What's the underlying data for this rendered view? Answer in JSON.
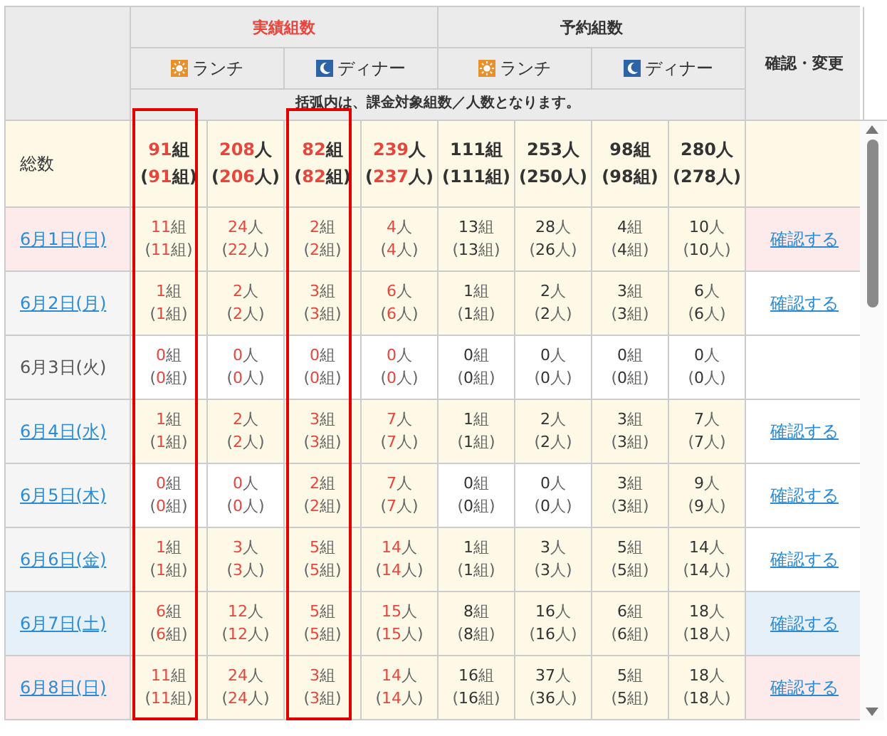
{
  "header": {
    "groups": [
      {
        "kind": "actual",
        "label": "実績組数"
      },
      {
        "kind": "reserved",
        "label": "予約組数"
      }
    ],
    "meals": [
      {
        "kind": "sun",
        "label": "ランチ"
      },
      {
        "kind": "moon",
        "label": "ディナー"
      },
      {
        "kind": "sun",
        "label": "ランチ"
      },
      {
        "kind": "moon",
        "label": "ディナー"
      }
    ],
    "note": "括弧内は、課金対象組数／人数となります。",
    "confirm_label": "確認・変更"
  },
  "columns": [
    {
      "kind": "actual",
      "framed": true
    },
    {
      "kind": "actual",
      "framed": false
    },
    {
      "kind": "actual",
      "framed": true
    },
    {
      "kind": "actual",
      "framed": false
    },
    {
      "kind": "reserved",
      "framed": false
    },
    {
      "kind": "reserved",
      "framed": false
    },
    {
      "kind": "reserved",
      "framed": false
    },
    {
      "kind": "reserved",
      "framed": false
    }
  ],
  "total": {
    "label": "総数",
    "cells": [
      {
        "value": [
          "91",
          "組"
        ],
        "billable": [
          "(",
          "91",
          "組)"
        ]
      },
      {
        "value": [
          "208",
          "人"
        ],
        "billable": [
          "(",
          "206",
          "人)"
        ]
      },
      {
        "value": [
          "82",
          "組"
        ],
        "billable": [
          "(",
          "82",
          "組)"
        ]
      },
      {
        "value": [
          "239",
          "人"
        ],
        "billable": [
          "(",
          "237",
          "人)"
        ]
      },
      {
        "value": [
          "111",
          "組"
        ],
        "billable": [
          "(",
          "111",
          "組)"
        ]
      },
      {
        "value": [
          "253",
          "人"
        ],
        "billable": [
          "(",
          "250",
          "人)"
        ]
      },
      {
        "value": [
          "98",
          "組"
        ],
        "billable": [
          "(",
          "98",
          "組)"
        ]
      },
      {
        "value": [
          "280",
          "人"
        ],
        "billable": [
          "(",
          "278",
          "人)"
        ]
      }
    ]
  },
  "rows": [
    {
      "date": "6月1日(日)",
      "kind": "sunday",
      "link": true,
      "action": "確認する",
      "cells": [
        {
          "value": [
            "11",
            "組"
          ],
          "billable": [
            "(",
            "11",
            "組)"
          ],
          "filled": true
        },
        {
          "value": [
            "24",
            "人"
          ],
          "billable": [
            "(",
            "22",
            "人)"
          ],
          "filled": true
        },
        {
          "value": [
            "2",
            "組"
          ],
          "billable": [
            "(",
            "2",
            "組)"
          ],
          "filled": true
        },
        {
          "value": [
            "4",
            "人"
          ],
          "billable": [
            "(",
            "4",
            "人)"
          ],
          "filled": true
        },
        {
          "value": [
            "13",
            "組"
          ],
          "billable": [
            "(",
            "13",
            "組)"
          ],
          "filled": true
        },
        {
          "value": [
            "28",
            "人"
          ],
          "billable": [
            "(",
            "26",
            "人)"
          ],
          "filled": true
        },
        {
          "value": [
            "4",
            "組"
          ],
          "billable": [
            "(",
            "4",
            "組)"
          ],
          "filled": true
        },
        {
          "value": [
            "10",
            "人"
          ],
          "billable": [
            "(",
            "10",
            "人)"
          ],
          "filled": true
        }
      ]
    },
    {
      "date": "6月2日(月)",
      "kind": "weekday",
      "link": true,
      "action": "確認する",
      "cells": [
        {
          "value": [
            "1",
            "組"
          ],
          "billable": [
            "(",
            "1",
            "組)"
          ],
          "filled": true
        },
        {
          "value": [
            "2",
            "人"
          ],
          "billable": [
            "(",
            "2",
            "人)"
          ],
          "filled": true
        },
        {
          "value": [
            "3",
            "組"
          ],
          "billable": [
            "(",
            "3",
            "組)"
          ],
          "filled": true
        },
        {
          "value": [
            "6",
            "人"
          ],
          "billable": [
            "(",
            "6",
            "人)"
          ],
          "filled": true
        },
        {
          "value": [
            "1",
            "組"
          ],
          "billable": [
            "(",
            "1",
            "組)"
          ],
          "filled": true
        },
        {
          "value": [
            "2",
            "人"
          ],
          "billable": [
            "(",
            "2",
            "人)"
          ],
          "filled": true
        },
        {
          "value": [
            "3",
            "組"
          ],
          "billable": [
            "(",
            "3",
            "組)"
          ],
          "filled": true
        },
        {
          "value": [
            "6",
            "人"
          ],
          "billable": [
            "(",
            "6",
            "人)"
          ],
          "filled": true
        }
      ]
    },
    {
      "date": "6月3日(火)",
      "kind": "weekday",
      "link": false,
      "cells": [
        {
          "value": [
            "0",
            "組"
          ],
          "billable": [
            "(",
            "0",
            "組)"
          ],
          "filled": false
        },
        {
          "value": [
            "0",
            "人"
          ],
          "billable": [
            "(",
            "0",
            "人)"
          ],
          "filled": false
        },
        {
          "value": [
            "0",
            "組"
          ],
          "billable": [
            "(",
            "0",
            "組)"
          ],
          "filled": false
        },
        {
          "value": [
            "0",
            "人"
          ],
          "billable": [
            "(",
            "0",
            "人)"
          ],
          "filled": false
        },
        {
          "value": [
            "0",
            "組"
          ],
          "billable": [
            "(",
            "0",
            "組)"
          ],
          "filled": false
        },
        {
          "value": [
            "0",
            "人"
          ],
          "billable": [
            "(",
            "0",
            "人)"
          ],
          "filled": false
        },
        {
          "value": [
            "0",
            "組"
          ],
          "billable": [
            "(",
            "0",
            "組)"
          ],
          "filled": false
        },
        {
          "value": [
            "0",
            "人"
          ],
          "billable": [
            "(",
            "0",
            "人)"
          ],
          "filled": false
        }
      ]
    },
    {
      "date": "6月4日(水)",
      "kind": "weekday",
      "link": true,
      "action": "確認する",
      "cells": [
        {
          "value": [
            "1",
            "組"
          ],
          "billable": [
            "(",
            "1",
            "組)"
          ],
          "filled": true
        },
        {
          "value": [
            "2",
            "人"
          ],
          "billable": [
            "(",
            "2",
            "人)"
          ],
          "filled": true
        },
        {
          "value": [
            "3",
            "組"
          ],
          "billable": [
            "(",
            "3",
            "組)"
          ],
          "filled": true
        },
        {
          "value": [
            "7",
            "人"
          ],
          "billable": [
            "(",
            "7",
            "人)"
          ],
          "filled": true
        },
        {
          "value": [
            "1",
            "組"
          ],
          "billable": [
            "(",
            "1",
            "組)"
          ],
          "filled": true
        },
        {
          "value": [
            "2",
            "人"
          ],
          "billable": [
            "(",
            "2",
            "人)"
          ],
          "filled": true
        },
        {
          "value": [
            "3",
            "組"
          ],
          "billable": [
            "(",
            "3",
            "組)"
          ],
          "filled": true
        },
        {
          "value": [
            "7",
            "人"
          ],
          "billable": [
            "(",
            "7",
            "人)"
          ],
          "filled": true
        }
      ]
    },
    {
      "date": "6月5日(木)",
      "kind": "weekday",
      "link": true,
      "action": "確認する",
      "cells": [
        {
          "value": [
            "0",
            "組"
          ],
          "billable": [
            "(",
            "0",
            "組)"
          ],
          "filled": false
        },
        {
          "value": [
            "0",
            "人"
          ],
          "billable": [
            "(",
            "0",
            "人)"
          ],
          "filled": false
        },
        {
          "value": [
            "2",
            "組"
          ],
          "billable": [
            "(",
            "2",
            "組)"
          ],
          "filled": true
        },
        {
          "value": [
            "7",
            "人"
          ],
          "billable": [
            "(",
            "7",
            "人)"
          ],
          "filled": true
        },
        {
          "value": [
            "0",
            "組"
          ],
          "billable": [
            "(",
            "0",
            "組)"
          ],
          "filled": false
        },
        {
          "value": [
            "0",
            "人"
          ],
          "billable": [
            "(",
            "0",
            "人)"
          ],
          "filled": false
        },
        {
          "value": [
            "3",
            "組"
          ],
          "billable": [
            "(",
            "3",
            "組)"
          ],
          "filled": true
        },
        {
          "value": [
            "9",
            "人"
          ],
          "billable": [
            "(",
            "9",
            "人)"
          ],
          "filled": true
        }
      ]
    },
    {
      "date": "6月6日(金)",
      "kind": "weekday",
      "link": true,
      "action": "確認する",
      "cells": [
        {
          "value": [
            "1",
            "組"
          ],
          "billable": [
            "(",
            "1",
            "組)"
          ],
          "filled": true
        },
        {
          "value": [
            "3",
            "人"
          ],
          "billable": [
            "(",
            "3",
            "人)"
          ],
          "filled": true
        },
        {
          "value": [
            "5",
            "組"
          ],
          "billable": [
            "(",
            "5",
            "組)"
          ],
          "filled": true
        },
        {
          "value": [
            "14",
            "人"
          ],
          "billable": [
            "(",
            "14",
            "人)"
          ],
          "filled": true
        },
        {
          "value": [
            "1",
            "組"
          ],
          "billable": [
            "(",
            "1",
            "組)"
          ],
          "filled": true
        },
        {
          "value": [
            "3",
            "人"
          ],
          "billable": [
            "(",
            "3",
            "人)"
          ],
          "filled": true
        },
        {
          "value": [
            "5",
            "組"
          ],
          "billable": [
            "(",
            "5",
            "組)"
          ],
          "filled": true
        },
        {
          "value": [
            "14",
            "人"
          ],
          "billable": [
            "(",
            "14",
            "人)"
          ],
          "filled": true
        }
      ]
    },
    {
      "date": "6月7日(土)",
      "kind": "saturday",
      "link": true,
      "action": "確認する",
      "cells": [
        {
          "value": [
            "6",
            "組"
          ],
          "billable": [
            "(",
            "6",
            "組)"
          ],
          "filled": true
        },
        {
          "value": [
            "12",
            "人"
          ],
          "billable": [
            "(",
            "12",
            "人)"
          ],
          "filled": true
        },
        {
          "value": [
            "5",
            "組"
          ],
          "billable": [
            "(",
            "5",
            "組)"
          ],
          "filled": true
        },
        {
          "value": [
            "15",
            "人"
          ],
          "billable": [
            "(",
            "15",
            "人)"
          ],
          "filled": true
        },
        {
          "value": [
            "8",
            "組"
          ],
          "billable": [
            "(",
            "8",
            "組)"
          ],
          "filled": true
        },
        {
          "value": [
            "16",
            "人"
          ],
          "billable": [
            "(",
            "16",
            "人)"
          ],
          "filled": true
        },
        {
          "value": [
            "6",
            "組"
          ],
          "billable": [
            "(",
            "6",
            "組)"
          ],
          "filled": true
        },
        {
          "value": [
            "18",
            "人"
          ],
          "billable": [
            "(",
            "18",
            "人)"
          ],
          "filled": true
        }
      ]
    },
    {
      "date": "6月8日(日)",
      "kind": "sunday",
      "link": true,
      "action": "確認する",
      "cells": [
        {
          "value": [
            "11",
            "組"
          ],
          "billable": [
            "(",
            "11",
            "組)"
          ],
          "filled": true
        },
        {
          "value": [
            "24",
            "人"
          ],
          "billable": [
            "(",
            "24",
            "人)"
          ],
          "filled": true
        },
        {
          "value": [
            "3",
            "組"
          ],
          "billable": [
            "(",
            "3",
            "組)"
          ],
          "filled": true
        },
        {
          "value": [
            "14",
            "人"
          ],
          "billable": [
            "(",
            "14",
            "人)"
          ],
          "filled": true
        },
        {
          "value": [
            "16",
            "組"
          ],
          "billable": [
            "(",
            "16",
            "組)"
          ],
          "filled": true
        },
        {
          "value": [
            "37",
            "人"
          ],
          "billable": [
            "(",
            "36",
            "人)"
          ],
          "filled": true
        },
        {
          "value": [
            "5",
            "組"
          ],
          "billable": [
            "(",
            "5",
            "組)"
          ],
          "filled": true
        },
        {
          "value": [
            "18",
            "人"
          ],
          "billable": [
            "(",
            "18",
            "人)"
          ],
          "filled": true
        }
      ]
    }
  ]
}
